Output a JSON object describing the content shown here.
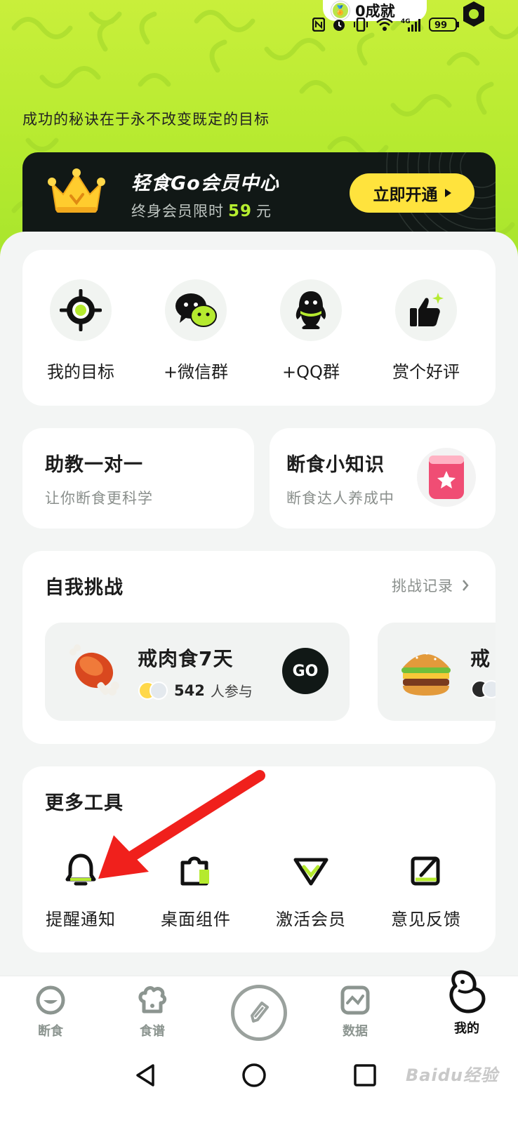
{
  "status_bar": {
    "achievement_text": "0成就",
    "battery": "99",
    "network": "4G"
  },
  "motto": "成功的秘诀在于永不改变既定的目标",
  "member": {
    "title": "轻食Go会员中心",
    "subtitle_prefix": "终身会员限时",
    "price": "59",
    "unit": "元",
    "button": "立即开通"
  },
  "quick_actions": [
    {
      "label": "我的目标",
      "icon": "target-icon"
    },
    {
      "label": "+微信群",
      "icon": "wechat-icon"
    },
    {
      "label": "+QQ群",
      "icon": "qq-icon"
    },
    {
      "label": "赏个好评",
      "icon": "thumbs-up-icon"
    }
  ],
  "assistant": {
    "title": "助教一对一",
    "subtitle": "让你断食更科学"
  },
  "knowledge": {
    "title": "断食小知识",
    "subtitle": "断食达人养成中"
  },
  "challenge": {
    "title": "自我挑战",
    "link": "挑战记录",
    "items": [
      {
        "name": "戒肉食7天",
        "count": "542",
        "suffix": "人参与",
        "go": "GO"
      },
      {
        "name": "戒",
        "count": "",
        "suffix": "",
        "go": ""
      }
    ]
  },
  "tools": {
    "title": "更多工具",
    "items": [
      {
        "label": "提醒通知",
        "icon": "bell-icon"
      },
      {
        "label": "桌面组件",
        "icon": "widget-icon"
      },
      {
        "label": "激活会员",
        "icon": "vip-diamond-icon"
      },
      {
        "label": "意见反馈",
        "icon": "feedback-edit-icon"
      }
    ]
  },
  "bottom_nav": [
    {
      "label": "断食",
      "active": false
    },
    {
      "label": "食谱",
      "active": false
    },
    {
      "label": "",
      "active": false
    },
    {
      "label": "数据",
      "active": false
    },
    {
      "label": "我的",
      "active": true
    }
  ],
  "watermark": "Baidu经验",
  "colors": {
    "brand_green": "#b5ea2f",
    "dark": "#111816",
    "member_yellow": "#ffe33d",
    "arrow_red": "#f0201c"
  }
}
